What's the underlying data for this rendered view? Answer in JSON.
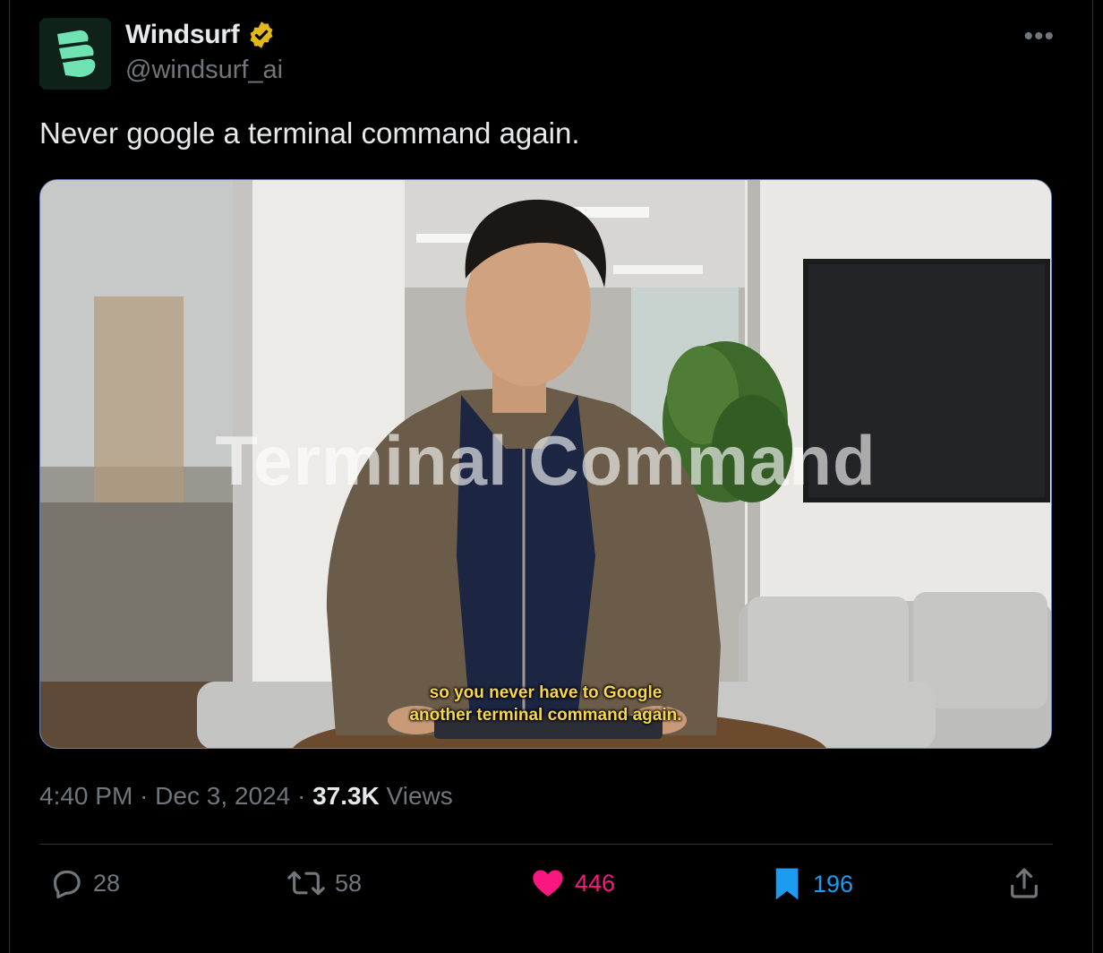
{
  "author": {
    "name": "Windsurf",
    "handle": "@windsurf_ai",
    "verified_icon": "verified-badge-icon",
    "avatar_icon": "windsurf-logo-icon"
  },
  "more_label": "•••",
  "tweet": {
    "text": "Never google a terminal command again."
  },
  "video": {
    "title_overlay": "Terminal Command",
    "caption_line1": "so you never have to Google",
    "caption_line2": "another terminal command again."
  },
  "meta": {
    "time": "4:40 PM",
    "sep1": " · ",
    "date": "Dec 3, 2024",
    "sep2": " · ",
    "views_count": "37.3K",
    "views_label": " Views"
  },
  "actions": {
    "reply_count": "28",
    "retweet_count": "58",
    "like_count": "446",
    "bookmark_count": "196"
  },
  "colors": {
    "like": "#f91880",
    "bookmark": "#1d9bf0",
    "verified": "#e2b719",
    "muted": "#71767b",
    "brand": "#6fe3b1"
  }
}
